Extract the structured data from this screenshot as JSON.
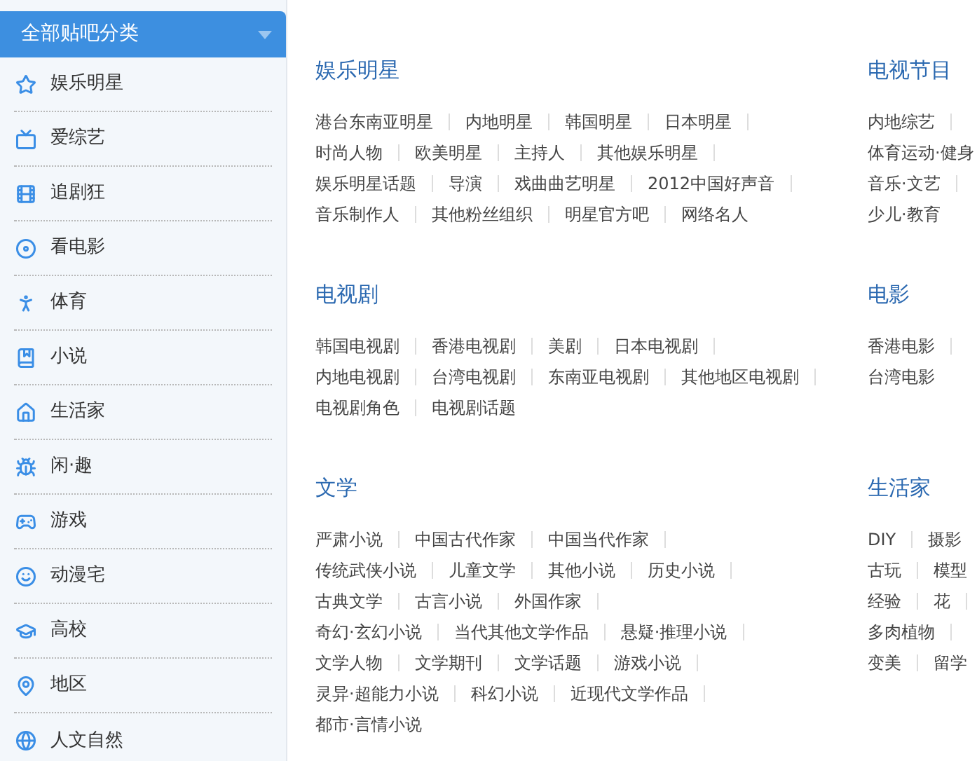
{
  "sidebar": {
    "title": "全部贴吧分类",
    "items": [
      {
        "label": "娱乐明星"
      },
      {
        "label": "爱综艺"
      },
      {
        "label": "追剧狂"
      },
      {
        "label": "看电影"
      },
      {
        "label": "体育"
      },
      {
        "label": "小说"
      },
      {
        "label": "生活家"
      },
      {
        "label": "闲·趣"
      },
      {
        "label": "游戏"
      },
      {
        "label": "动漫宅"
      },
      {
        "label": "高校"
      },
      {
        "label": "地区"
      },
      {
        "label": "人文自然"
      }
    ]
  },
  "sections": [
    {
      "title": "娱乐明星",
      "lines": [
        [
          "港台东南亚明星",
          "内地明星",
          "韩国明星",
          "日本明星"
        ],
        [
          "时尚人物",
          "欧美明星",
          "主持人",
          "其他娱乐明星"
        ],
        [
          "娱乐明星话题",
          "导演",
          "戏曲曲艺明星",
          "2012中国好声音"
        ],
        [
          "音乐制作人",
          "其他粉丝组织",
          "明星官方吧",
          "网络名人"
        ]
      ]
    },
    {
      "title": "电视节目",
      "lines": [
        [
          "内地综艺"
        ],
        [
          "体育运动·健身"
        ],
        [
          "音乐·文艺"
        ],
        [
          "少儿·教育"
        ]
      ]
    },
    {
      "title": "电视剧",
      "lines": [
        [
          "韩国电视剧",
          "香港电视剧",
          "美剧",
          "日本电视剧"
        ],
        [
          "内地电视剧",
          "台湾电视剧",
          "东南亚电视剧",
          "其他地区电视剧"
        ],
        [
          "电视剧角色",
          "电视剧话题"
        ]
      ]
    },
    {
      "title": "电影",
      "lines": [
        [
          "香港电影"
        ],
        [
          "台湾电影"
        ]
      ]
    },
    {
      "title": "文学",
      "lines": [
        [
          "严肃小说",
          "中国古代作家",
          "中国当代作家"
        ],
        [
          "传统武侠小说",
          "儿童文学",
          "其他小说",
          "历史小说"
        ],
        [
          "古典文学",
          "古言小说",
          "外国作家"
        ],
        [
          "奇幻·玄幻小说",
          "当代其他文学作品",
          "悬疑·推理小说"
        ],
        [
          "文学人物",
          "文学期刊",
          "文学话题",
          "游戏小说"
        ],
        [
          "灵异·超能力小说",
          "科幻小说",
          "近现代文学作品"
        ],
        [
          "都市·言情小说"
        ]
      ]
    },
    {
      "title": "生活家",
      "lines": [
        [
          "DIY",
          "摄影"
        ],
        [
          "古玩",
          "模型"
        ],
        [
          "经验",
          "花"
        ],
        [
          "多肉植物"
        ],
        [
          "变美",
          "留学"
        ]
      ]
    }
  ]
}
